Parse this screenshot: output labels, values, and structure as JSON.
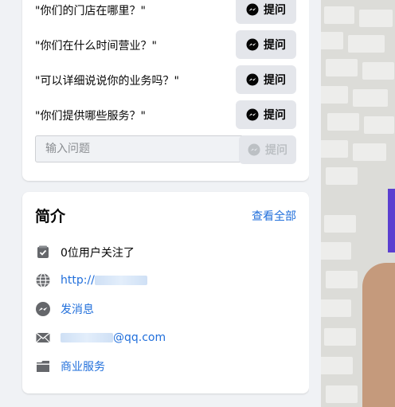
{
  "questions": {
    "items": [
      {
        "text": "\"你们的门店在哪里？\"",
        "button_label": "提问"
      },
      {
        "text": "\"你们在什么时间营业？\"",
        "button_label": "提问"
      },
      {
        "text": "\"可以详细说说你的业务吗？\"",
        "button_label": "提问"
      },
      {
        "text": "\"你们提供哪些服务？\"",
        "button_label": "提问"
      }
    ],
    "input_placeholder": "输入问题",
    "send_label": "提问"
  },
  "intro": {
    "title": "简介",
    "see_all": "查看全部",
    "followers": "0位用户关注了",
    "website_prefix": "http://",
    "message_label": "发消息",
    "email_suffix": "@qq.com",
    "category": "商业服务"
  },
  "colors": {
    "accent": "#216fdb",
    "button_bg": "#e4e6eb",
    "page_bg": "#f0f2f5"
  },
  "icons": [
    "messenger-icon",
    "checkbox-icon",
    "globe-icon",
    "mail-icon",
    "briefcase-icon"
  ]
}
